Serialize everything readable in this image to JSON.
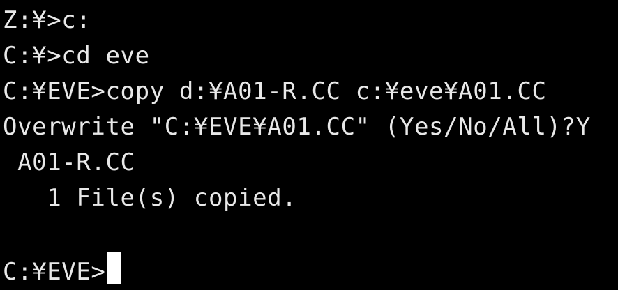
{
  "terminal": {
    "lines": [
      "Z:¥>c:",
      "C:¥>cd eve",
      "C:¥EVE>copy d:¥A01-R.CC c:¥eve¥A01.CC",
      "Overwrite \"C:¥EVE¥A01.CC\" (Yes/No/All)?Y",
      " A01-R.CC",
      "   1 File(s) copied.",
      "",
      "C:¥EVE>"
    ],
    "colors": {
      "background": "#000000",
      "text": "#e8e8e8",
      "cursor": "#ffffff"
    }
  }
}
